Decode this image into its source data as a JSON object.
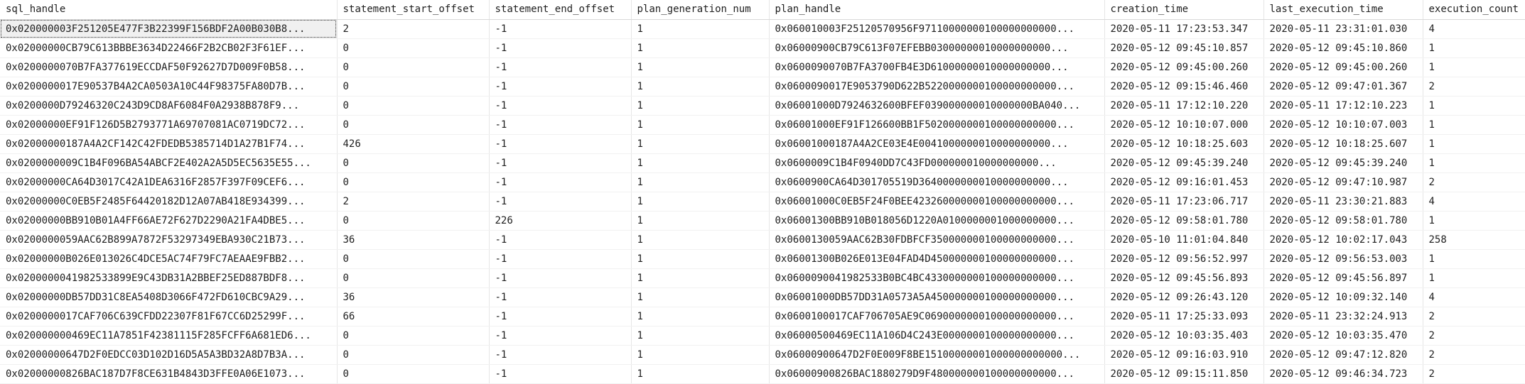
{
  "columns": [
    "sql_handle",
    "statement_start_offset",
    "statement_end_offset",
    "plan_generation_num",
    "plan_handle",
    "creation_time",
    "last_execution_time",
    "execution_count"
  ],
  "rows": [
    [
      "0x020000003F251205E477F3B22399F156BDF2A00B030B8...",
      "2",
      "-1",
      "1",
      "0x060010003F25120570956F97110000000100000000000...",
      "2020-05-11 17:23:53.347",
      "2020-05-11 23:31:01.030",
      "4"
    ],
    [
      "0x02000000CB79C613BBBE3634D22466F2B2CB02F3F61EF...",
      "0",
      "-1",
      "1",
      "0x06000900CB79C613F07EFEBB03000000010000000000...",
      "2020-05-12 09:45:10.857",
      "2020-05-12 09:45:10.860",
      "1"
    ],
    [
      "0x0200000070B7FA377619ECCDAF50F92627D7D009F0B58...",
      "0",
      "-1",
      "1",
      "0x0600090070B7FA3700FB4E3D61000000010000000000...",
      "2020-05-12 09:45:00.260",
      "2020-05-12 09:45:00.260",
      "1"
    ],
    [
      "0x0200000017E90537B4A2CA0503A10C44F98375FA80D7B...",
      "0",
      "-1",
      "1",
      "0x0600090017E9053790D622B5220000000100000000000...",
      "2020-05-12 09:15:46.460",
      "2020-05-12 09:47:01.367",
      "2"
    ],
    [
      "0x0200000D79246320C243D9CD8AF6084F0A2938B878F9...",
      "0",
      "-1",
      "1",
      "0x06001000D7924632600BFEF039000000010000000BA040...",
      "2020-05-11 17:12:10.220",
      "2020-05-11 17:12:10.223",
      "1"
    ],
    [
      "0x02000000EF91F126D5B2793771A69707081AC0719DC72...",
      "0",
      "-1",
      "1",
      "0x06001000EF91F126600BB1F5020000000100000000000...",
      "2020-05-12 10:10:07.000",
      "2020-05-12 10:10:07.003",
      "1"
    ],
    [
      "0x02000000187A4A2CF142C42FDEDB5385714D1A27B1F74...",
      "426",
      "-1",
      "1",
      "0x06001000187A4A2CE03E4E0041000000010000000000...",
      "2020-05-12 10:18:25.603",
      "2020-05-12 10:18:25.607",
      "1"
    ],
    [
      "0x0200000009C1B4F096BA54ABCF2E402A2A5D5EC5635E55...",
      "0",
      "-1",
      "1",
      "0x0600009C1B4F0940DD7C43FD000000010000000000...",
      "2020-05-12 09:45:39.240",
      "2020-05-12 09:45:39.240",
      "1"
    ],
    [
      "0x02000000CA64D3017C42A1DEA6316F2857F397F09CEF6...",
      "0",
      "-1",
      "1",
      "0x0600900CA64D301705519D3640000000010000000000...",
      "2020-05-12 09:16:01.453",
      "2020-05-12 09:47:10.987",
      "2"
    ],
    [
      "0x02000000C0EB5F2485F64420182D12A07AB418E934399...",
      "2",
      "-1",
      "1",
      "0x06001000C0EB5F24F0BEE423260000000100000000000...",
      "2020-05-11 17:23:06.717",
      "2020-05-11 23:30:21.883",
      "4"
    ],
    [
      "0x02000000BB910B01A4FF66AE72F627D2290A21FA4DBE5...",
      "0",
      "226",
      "1",
      "0x06001300BB910B018056D1220A0100000001000000000...",
      "2020-05-12 09:58:01.780",
      "2020-05-12 09:58:01.780",
      "1"
    ],
    [
      "0x0200000059AAC62B899A7872F53297349EBA930C21B73...",
      "36",
      "-1",
      "1",
      "0x0600130059AAC62B30FDBFCF350000000100000000000...",
      "2020-05-10 11:01:04.840",
      "2020-05-12 10:02:17.043",
      "258"
    ],
    [
      "0x02000000B026E013026C4DCE5AC74F79FC7AEAAE9FBB2...",
      "0",
      "-1",
      "1",
      "0x06001300B026E013E04FAD4D450000000100000000000...",
      "2020-05-12 09:56:52.997",
      "2020-05-12 09:56:53.003",
      "1"
    ],
    [
      "0x0200000041982533899E9C43DB31A2BBEF25ED887BDF8...",
      "0",
      "-1",
      "1",
      "0x0600090041982533B0BC4BC4330000000100000000000...",
      "2020-05-12 09:45:56.893",
      "2020-05-12 09:45:56.897",
      "1"
    ],
    [
      "0x02000000DB57DD31C8EA5408D3066F472FD610CBC9A29...",
      "36",
      "-1",
      "1",
      "0x06001000DB57DD31A0573A5A450000000100000000000...",
      "2020-05-12 09:26:43.120",
      "2020-05-12 10:09:32.140",
      "4"
    ],
    [
      "0x0200000017CAF706C639CFDD22307F81F67CC6D25299F...",
      "66",
      "-1",
      "1",
      "0x0600100017CAF706705AE9C0690000000100000000000...",
      "2020-05-11 17:25:33.093",
      "2020-05-11 23:32:24.913",
      "2"
    ],
    [
      "0x020000000469EC11A7851F42381115F285FCFF6A681ED6...",
      "0",
      "-1",
      "1",
      "0x06000500469EC11A106D4C243E0000000100000000000...",
      "2020-05-12 10:03:35.403",
      "2020-05-12 10:03:35.470",
      "2"
    ],
    [
      "0x02000000647D2F0EDCC03D102D16D5A5A3BD32A8D7B3A...",
      "0",
      "-1",
      "1",
      "0x06000900647D2F0E009F8BE15100000001000000000000...",
      "2020-05-12 09:16:03.910",
      "2020-05-12 09:47:12.820",
      "2"
    ],
    [
      "0x02000000826BAC187D7F8CE631B4843D3FFE0A06E1073...",
      "0",
      "-1",
      "1",
      "0x06000900826BAC1880279D9F480000000100000000000...",
      "2020-05-12 09:15:11.850",
      "2020-05-12 09:46:34.723",
      "2"
    ]
  ]
}
